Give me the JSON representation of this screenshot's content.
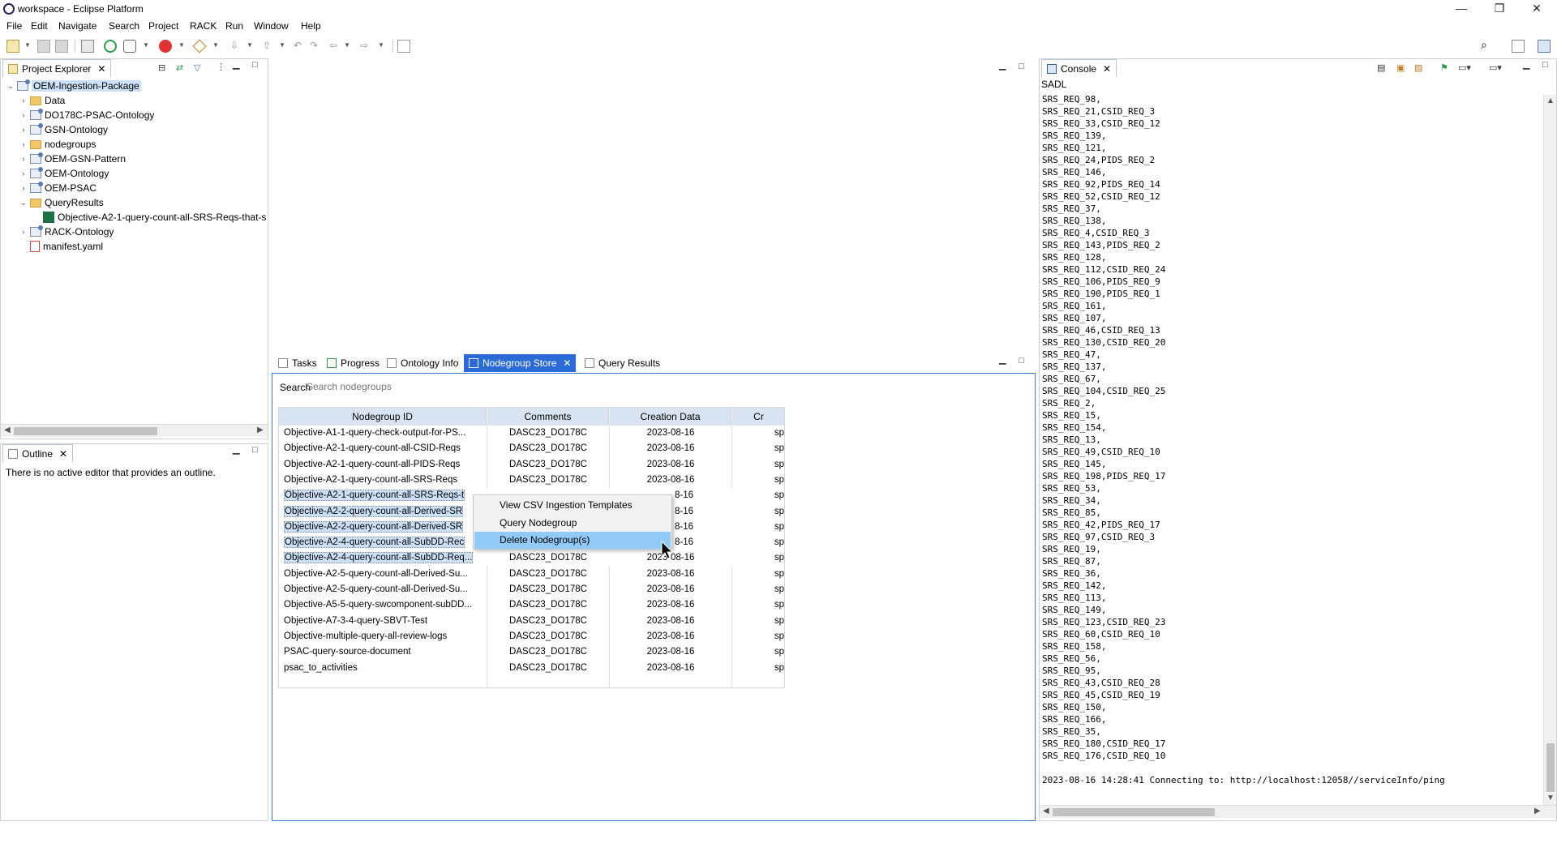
{
  "window": {
    "title": "workspace - Eclipse Platform",
    "minimize": "—",
    "restore": "❐",
    "close": "✕"
  },
  "menu": [
    "File",
    "Edit",
    "Navigate",
    "Search",
    "Project",
    "RACK",
    "Run",
    "Window",
    "Help"
  ],
  "project_explorer": {
    "tab_label": "Project Explorer",
    "items": [
      {
        "label": "OEM-Ingestion-Package",
        "type": "project",
        "twisty": "⌄",
        "selected": true
      },
      {
        "label": "Data",
        "type": "folder",
        "twisty": "›"
      },
      {
        "label": "DO178C-PSAC-Ontology",
        "type": "project",
        "twisty": "›"
      },
      {
        "label": "GSN-Ontology",
        "type": "project",
        "twisty": "›"
      },
      {
        "label": "nodegroups",
        "type": "folder",
        "twisty": "›"
      },
      {
        "label": "OEM-GSN-Pattern",
        "type": "project",
        "twisty": "›"
      },
      {
        "label": "OEM-Ontology",
        "type": "project",
        "twisty": "›"
      },
      {
        "label": "OEM-PSAC",
        "type": "project",
        "twisty": "›"
      },
      {
        "label": "QueryResults",
        "type": "folder",
        "twisty": "⌄"
      },
      {
        "label": "Objective-A2-1-query-count-all-SRS-Reqs-that-s",
        "type": "xls",
        "twisty": ""
      },
      {
        "label": "RACK-Ontology",
        "type": "project",
        "twisty": "›"
      },
      {
        "label": "manifest.yaml",
        "type": "yaml",
        "twisty": ""
      }
    ]
  },
  "outline": {
    "tab_label": "Outline",
    "message": "There is no active editor that provides an outline."
  },
  "bottom_tabs": [
    {
      "label": "Tasks",
      "selected": false
    },
    {
      "label": "Progress",
      "selected": false
    },
    {
      "label": "Ontology Info",
      "selected": false
    },
    {
      "label": "Nodegroup Store",
      "selected": true
    },
    {
      "label": "Query Results",
      "selected": false
    }
  ],
  "nodegroup_store": {
    "search_label": "Search",
    "search_placeholder": "Search nodegroups",
    "columns": [
      "Nodegroup ID",
      "Comments",
      "Creation Data",
      "Cr"
    ],
    "rows": [
      {
        "id": "Objective-A1-1-query-check-output-for-PS...",
        "comments": "DASC23_DO178C",
        "date": "2023-08-16",
        "cr": "sp",
        "selected": false
      },
      {
        "id": "Objective-A2-1-query-count-all-CSID-Reqs",
        "comments": "DASC23_DO178C",
        "date": "2023-08-16",
        "cr": "sp",
        "selected": false
      },
      {
        "id": "Objective-A2-1-query-count-all-PIDS-Reqs",
        "comments": "DASC23_DO178C",
        "date": "2023-08-16",
        "cr": "sp",
        "selected": false
      },
      {
        "id": "Objective-A2-1-query-count-all-SRS-Reqs",
        "comments": "DASC23_DO178C",
        "date": "2023-08-16",
        "cr": "sp",
        "selected": false
      },
      {
        "id": "Objective-A2-1-query-count-all-SRS-Reqs-t",
        "comments": "",
        "date": "8-16",
        "cr": "sp",
        "selected": true
      },
      {
        "id": "Objective-A2-2-query-count-all-Derived-SR",
        "comments": "",
        "date": "8-16",
        "cr": "sp",
        "selected": true
      },
      {
        "id": "Objective-A2-2-query-count-all-Derived-SR",
        "comments": "",
        "date": "8-16",
        "cr": "sp",
        "selected": true
      },
      {
        "id": "Objective-A2-4-query-count-all-SubDD-Rec",
        "comments": "",
        "date": "8-16",
        "cr": "sp",
        "selected": true
      },
      {
        "id": "Objective-A2-4-query-count-all-SubDD-Req...",
        "comments": "DASC23_DO178C",
        "date": "2023-08-16",
        "cr": "sp",
        "selected": true
      },
      {
        "id": "Objective-A2-5-query-count-all-Derived-Su...",
        "comments": "DASC23_DO178C",
        "date": "2023-08-16",
        "cr": "sp",
        "selected": false
      },
      {
        "id": "Objective-A2-5-query-count-all-Derived-Su...",
        "comments": "DASC23_DO178C",
        "date": "2023-08-16",
        "cr": "sp",
        "selected": false
      },
      {
        "id": "Objective-A5-5-query-swcomponent-subDD...",
        "comments": "DASC23_DO178C",
        "date": "2023-08-16",
        "cr": "sp",
        "selected": false
      },
      {
        "id": "Objective-A7-3-4-query-SBVT-Test",
        "comments": "DASC23_DO178C",
        "date": "2023-08-16",
        "cr": "sp",
        "selected": false
      },
      {
        "id": "Objective-multiple-query-all-review-logs",
        "comments": "DASC23_DO178C",
        "date": "2023-08-16",
        "cr": "sp",
        "selected": false
      },
      {
        "id": "PSAC-query-source-document",
        "comments": "DASC23_DO178C",
        "date": "2023-08-16",
        "cr": "sp",
        "selected": false
      },
      {
        "id": "psac_to_activities",
        "comments": "DASC23_DO178C",
        "date": "2023-08-16",
        "cr": "sp",
        "selected": false
      }
    ]
  },
  "context_menu": {
    "items": [
      {
        "label": "View CSV Ingestion Templates",
        "highlighted": false
      },
      {
        "label": "Query Nodegroup",
        "highlighted": false
      },
      {
        "label": "Delete Nodegroup(s)",
        "highlighted": true
      }
    ]
  },
  "console": {
    "tab_label": "Console",
    "name": "SADL",
    "lines": [
      "SRS_REQ_98,",
      "SRS_REQ_21,CSID_REQ_3",
      "SRS_REQ_33,CSID_REQ_12",
      "SRS_REQ_139,",
      "SRS_REQ_121,",
      "SRS_REQ_24,PIDS_REQ_2",
      "SRS_REQ_146,",
      "SRS_REQ_92,PIDS_REQ_14",
      "SRS_REQ_52,CSID_REQ_12",
      "SRS_REQ_37,",
      "SRS_REQ_138,",
      "SRS_REQ_4,CSID_REQ_3",
      "SRS_REQ_143,PIDS_REQ_2",
      "SRS_REQ_128,",
      "SRS_REQ_112,CSID_REQ_24",
      "SRS_REQ_106,PIDS_REQ_9",
      "SRS_REQ_190,PIDS_REQ_1",
      "SRS_REQ_161,",
      "SRS_REQ_107,",
      "SRS_REQ_46,CSID_REQ_13",
      "SRS_REQ_130,CSID_REQ_20",
      "SRS_REQ_47,",
      "SRS_REQ_137,",
      "SRS_REQ_67,",
      "SRS_REQ_104,CSID_REQ_25",
      "SRS_REQ_2,",
      "SRS_REQ_15,",
      "SRS_REQ_154,",
      "SRS_REQ_13,",
      "SRS_REQ_49,CSID_REQ_10",
      "SRS_REQ_145,",
      "SRS_REQ_198,PIDS_REQ_17",
      "SRS_REQ_53,",
      "SRS_REQ_34,",
      "SRS_REQ_85,",
      "SRS_REQ_42,PIDS_REQ_17",
      "SRS_REQ_97,CSID_REQ_3",
      "SRS_REQ_19,",
      "SRS_REQ_87,",
      "SRS_REQ_36,",
      "SRS_REQ_142,",
      "SRS_REQ_113,",
      "SRS_REQ_149,",
      "SRS_REQ_123,CSID_REQ_23",
      "SRS_REQ_60,CSID_REQ_10",
      "SRS_REQ_158,",
      "SRS_REQ_56,",
      "SRS_REQ_95,",
      "SRS_REQ_43,CSID_REQ_28",
      "SRS_REQ_45,CSID_REQ_19",
      "SRS_REQ_150,",
      "SRS_REQ_166,",
      "SRS_REQ_35,",
      "SRS_REQ_180,CSID_REQ_17",
      "SRS_REQ_176,CSID_REQ_10",
      "",
      "2023-08-16 14:28:41 Connecting to: http://localhost:12058//serviceInfo/ping"
    ]
  }
}
